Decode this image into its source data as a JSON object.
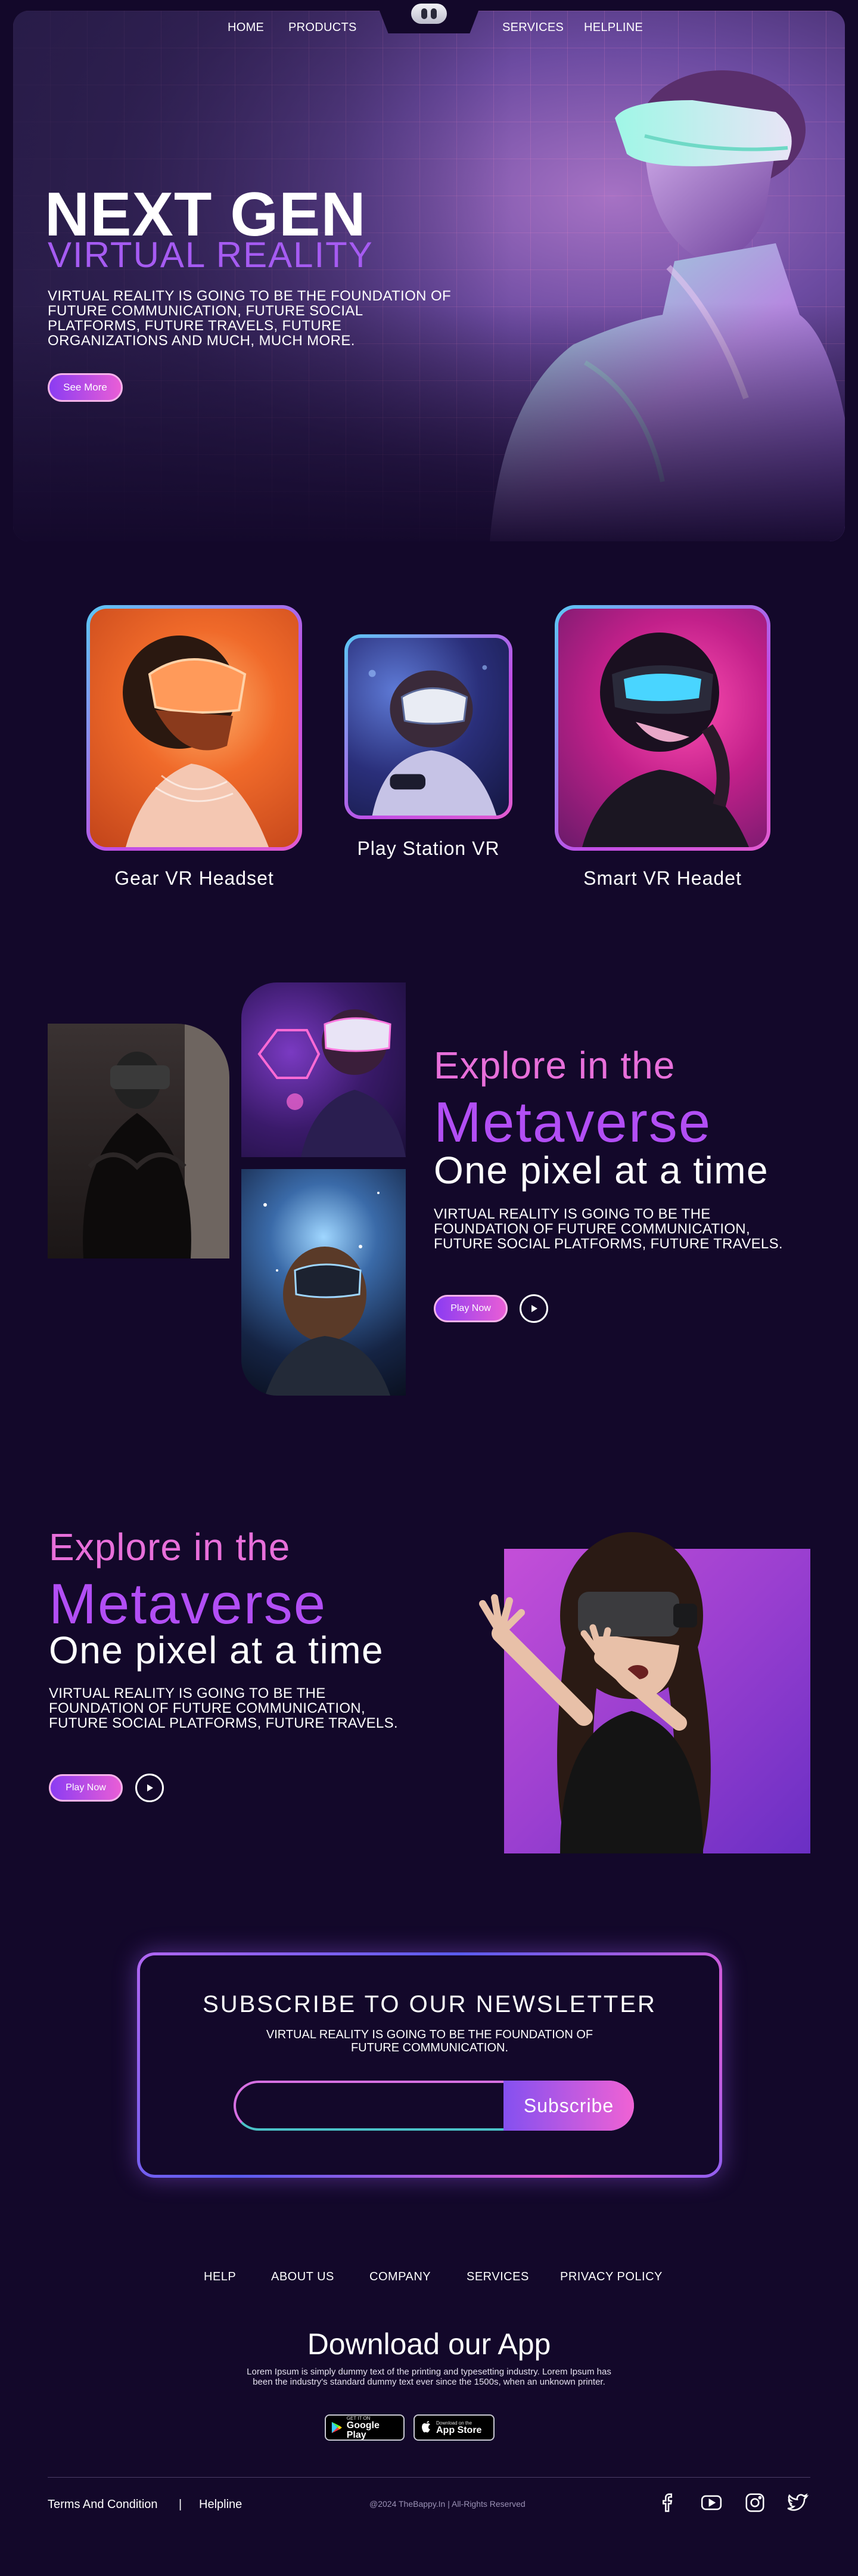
{
  "nav": {
    "items": [
      "HOME",
      "PRODUCTS",
      "SERVICES",
      "HELPLINE"
    ]
  },
  "hero": {
    "title": "NEXT GEN",
    "subtitle": "VIRTUAL REALITY",
    "text": "VIRTUAL REALITY IS GOING TO BE THE FOUNDATION OF FUTURE COMMUNICATION, FUTURE SOCIAL PLATFORMS, FUTURE TRAVELS, FUTURE ORGANIZATIONS AND MUCH, MUCH MORE.",
    "button": "See More"
  },
  "products": [
    {
      "label": "Gear  VR Headset"
    },
    {
      "label": "Play Station VR"
    },
    {
      "label": "Smart VR Headet"
    }
  ],
  "explore1": {
    "small": "Explore in the",
    "big": "Metaverse",
    "line": "One pixel at a time",
    "text": "VIRTUAL REALITY IS GOING TO BE THE FOUNDATION OF FUTURE COMMUNICATION, FUTURE SOCIAL PLATFORMS, FUTURE TRAVELS.",
    "button": "Play Now"
  },
  "explore2": {
    "small": "Explore in the",
    "big": "Metaverse",
    "line": "One pixel at a time",
    "text": "VIRTUAL REALITY IS GOING TO BE THE FOUNDATION OF FUTURE COMMUNICATION, FUTURE SOCIAL PLATFORMS, FUTURE TRAVELS.",
    "button": "Play Now"
  },
  "newsletter": {
    "title": "SUBSCRIBE TO OUR NEWSLETTER",
    "text": "VIRTUAL REALITY IS GOING TO BE THE FOUNDATION OF FUTURE COMMUNICATION.",
    "input_value": "",
    "button": "Subscribe"
  },
  "footer": {
    "links": [
      "HELP",
      "ABOUT US",
      "COMPANY",
      "SERVICES",
      "PRIVACY POLICY"
    ],
    "app_title": "Download our App",
    "app_text": "Lorem Ipsum is simply dummy text of the printing and typesetting industry. Lorem Ipsum has been the industry's standard dummy text ever since the 1500s, when an unknown printer.",
    "google_small": "GET IT ON",
    "google_big": "Google Play",
    "apple_small": "Download on the",
    "apple_big": "App Store",
    "terms": "Terms And Condition",
    "separator": "|",
    "helpline": "Helpline",
    "copyright": "@2024 TheBappy.In | All-Rights Reserved"
  },
  "colors": {
    "background": "#13082a",
    "accent_purple": "#a65bf2",
    "accent_pink": "#e86fda",
    "card_border": "#5bc8f5"
  },
  "icons": [
    "headset-logo-icon",
    "play-icon",
    "facebook-icon",
    "youtube-icon",
    "instagram-icon",
    "twitter-icon",
    "google-play-icon",
    "apple-icon"
  ]
}
